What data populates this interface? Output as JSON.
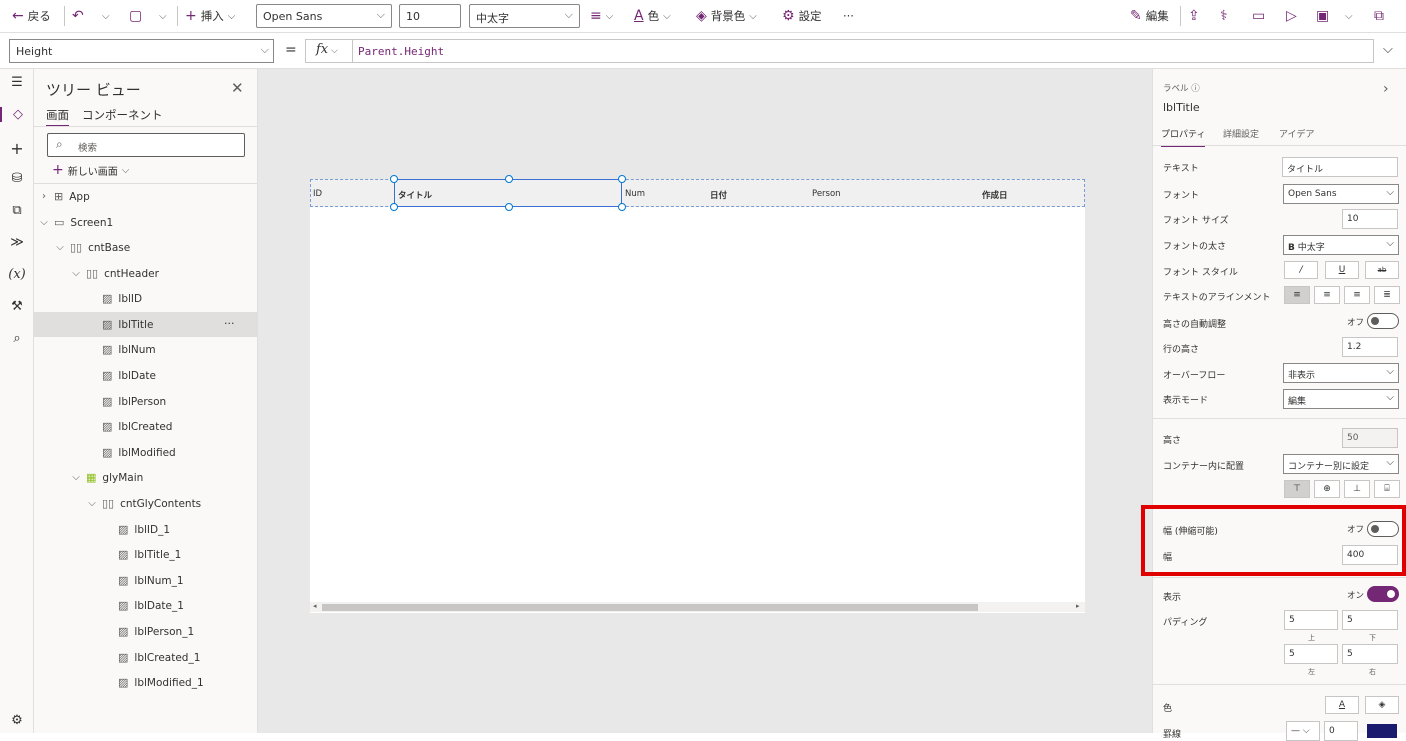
{
  "toolbar": {
    "back_label": "戻る",
    "insert_label": "挿入",
    "font_value": "Open Sans",
    "font_size_value": "10",
    "font_weight_value": "中太字",
    "color_label": "色",
    "bg_color_label": "背景色",
    "settings_label": "設定",
    "more_label": "···",
    "edit_label": "編集"
  },
  "formula": {
    "property_value": "Height",
    "equals": "=",
    "fx_label": "fx",
    "expression": "Parent.Height"
  },
  "tree": {
    "title": "ツリー ビュー",
    "tab_screens": "画面",
    "tab_components": "コンポーネント",
    "search_placeholder": "検索",
    "new_screen_label": "新しい画面",
    "items": [
      {
        "label": "App"
      },
      {
        "label": "Screen1"
      },
      {
        "label": "cntBase"
      },
      {
        "label": "cntHeader"
      },
      {
        "label": "lblID"
      },
      {
        "label": "lblTitle"
      },
      {
        "label": "lblNum"
      },
      {
        "label": "lblDate"
      },
      {
        "label": "lblPerson"
      },
      {
        "label": "lblCreated"
      },
      {
        "label": "lblModified"
      },
      {
        "label": "glyMain"
      },
      {
        "label": "cntGlyContents"
      },
      {
        "label": "lblID_1"
      },
      {
        "label": "lblTitle_1"
      },
      {
        "label": "lblNum_1"
      },
      {
        "label": "lblDate_1"
      },
      {
        "label": "lblPerson_1"
      },
      {
        "label": "lblCreated_1"
      },
      {
        "label": "lblModified_1"
      }
    ],
    "selected_more": "···"
  },
  "canvas": {
    "headers": [
      "ID",
      "タイトル",
      "Num",
      "日付",
      "Person",
      "作成日"
    ]
  },
  "props": {
    "type_label": "ラベル",
    "control_name": "lblTitle",
    "tab_properties": "プロパティ",
    "tab_advanced": "詳細設定",
    "tab_ideas": "アイデア",
    "text_label": "テキスト",
    "text_value": "タイトル",
    "font_label": "フォント",
    "font_value": "Open Sans",
    "font_size_label": "フォント サイズ",
    "font_size_value": "10",
    "font_weight_label": "フォントの太さ",
    "font_weight_value": "中太字",
    "font_style_label": "フォント スタイル",
    "italic": "/",
    "underline": "U",
    "strike": "ab",
    "align_label": "テキストのアラインメント",
    "autoheight_label": "高さの自動調整",
    "autoheight_state": "オフ",
    "line_height_label": "行の高さ",
    "line_height_value": "1.2",
    "overflow_label": "オーバーフロー",
    "overflow_value": "非表示",
    "display_mode_label": "表示モード",
    "display_mode_value": "編集",
    "height_label": "高さ",
    "height_value": "50",
    "container_align_label": "コンテナー内に配置",
    "container_align_value": "コンテナー別に設定",
    "flex_width_label": "幅 (伸縮可能)",
    "flex_width_state": "オフ",
    "width_label": "幅",
    "width_value": "400",
    "visible_label": "表示",
    "visible_state": "オン",
    "padding_label": "パディング",
    "pad_top": "5",
    "pad_bottom": "5",
    "pad_left": "5",
    "pad_right": "5",
    "pad_top_label": "上",
    "pad_bottom_label": "下",
    "pad_left_label": "左",
    "pad_right_label": "右",
    "color_label": "色",
    "border_label": "罫線",
    "border_value": "0"
  },
  "colors": {
    "accent": "#742774",
    "highlight_box": "#e00000",
    "selection": "#0078d4"
  }
}
